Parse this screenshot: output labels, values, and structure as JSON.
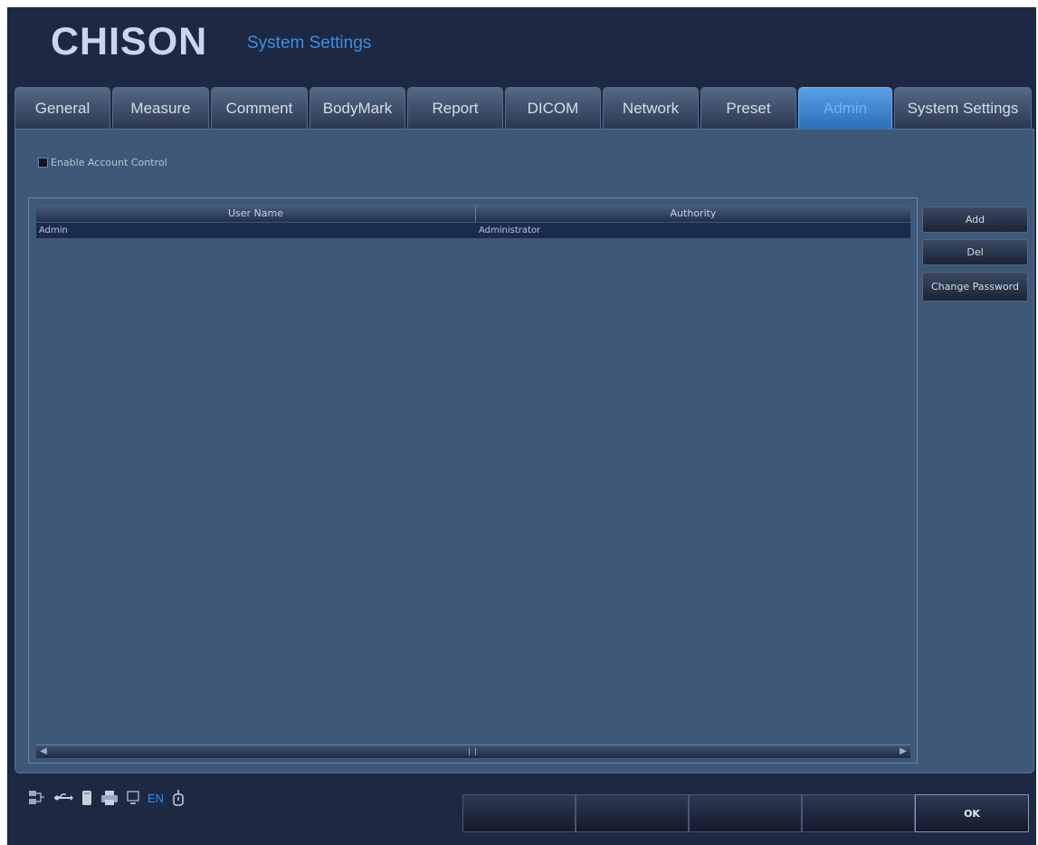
{
  "header": {
    "logo": "CHISON",
    "title": "System Settings"
  },
  "tabs": [
    {
      "label": "General",
      "active": false
    },
    {
      "label": "Measure",
      "active": false
    },
    {
      "label": "Comment",
      "active": false
    },
    {
      "label": "BodyMark",
      "active": false
    },
    {
      "label": "Report",
      "active": false
    },
    {
      "label": "DICOM",
      "active": false
    },
    {
      "label": "Network",
      "active": false
    },
    {
      "label": "Preset",
      "active": false
    },
    {
      "label": "Admin",
      "active": true
    },
    {
      "label": "System Settings",
      "active": false
    }
  ],
  "admin": {
    "enable_account_control": {
      "label": "Enable Account Control",
      "checked": true
    },
    "table": {
      "columns": [
        "User Name",
        "Authority"
      ],
      "rows": [
        {
          "user_name": "Admin",
          "authority": "Administrator",
          "selected": true
        }
      ]
    },
    "buttons": {
      "add": "Add",
      "del": "Del",
      "change_password": "Change Password"
    }
  },
  "footer": {
    "status_icons": [
      "network-icon",
      "usb-icon",
      "disk-icon",
      "printer-icon",
      "monitor-icon",
      "keyboard-icon"
    ],
    "language": "EN",
    "softkeys": [
      "",
      "",
      "",
      ""
    ],
    "ok_label": "OK"
  },
  "colors": {
    "background": "#1d2843",
    "panel": "#3d5878",
    "accent": "#3c8fe0",
    "selected_row": "#1b2a4f"
  }
}
